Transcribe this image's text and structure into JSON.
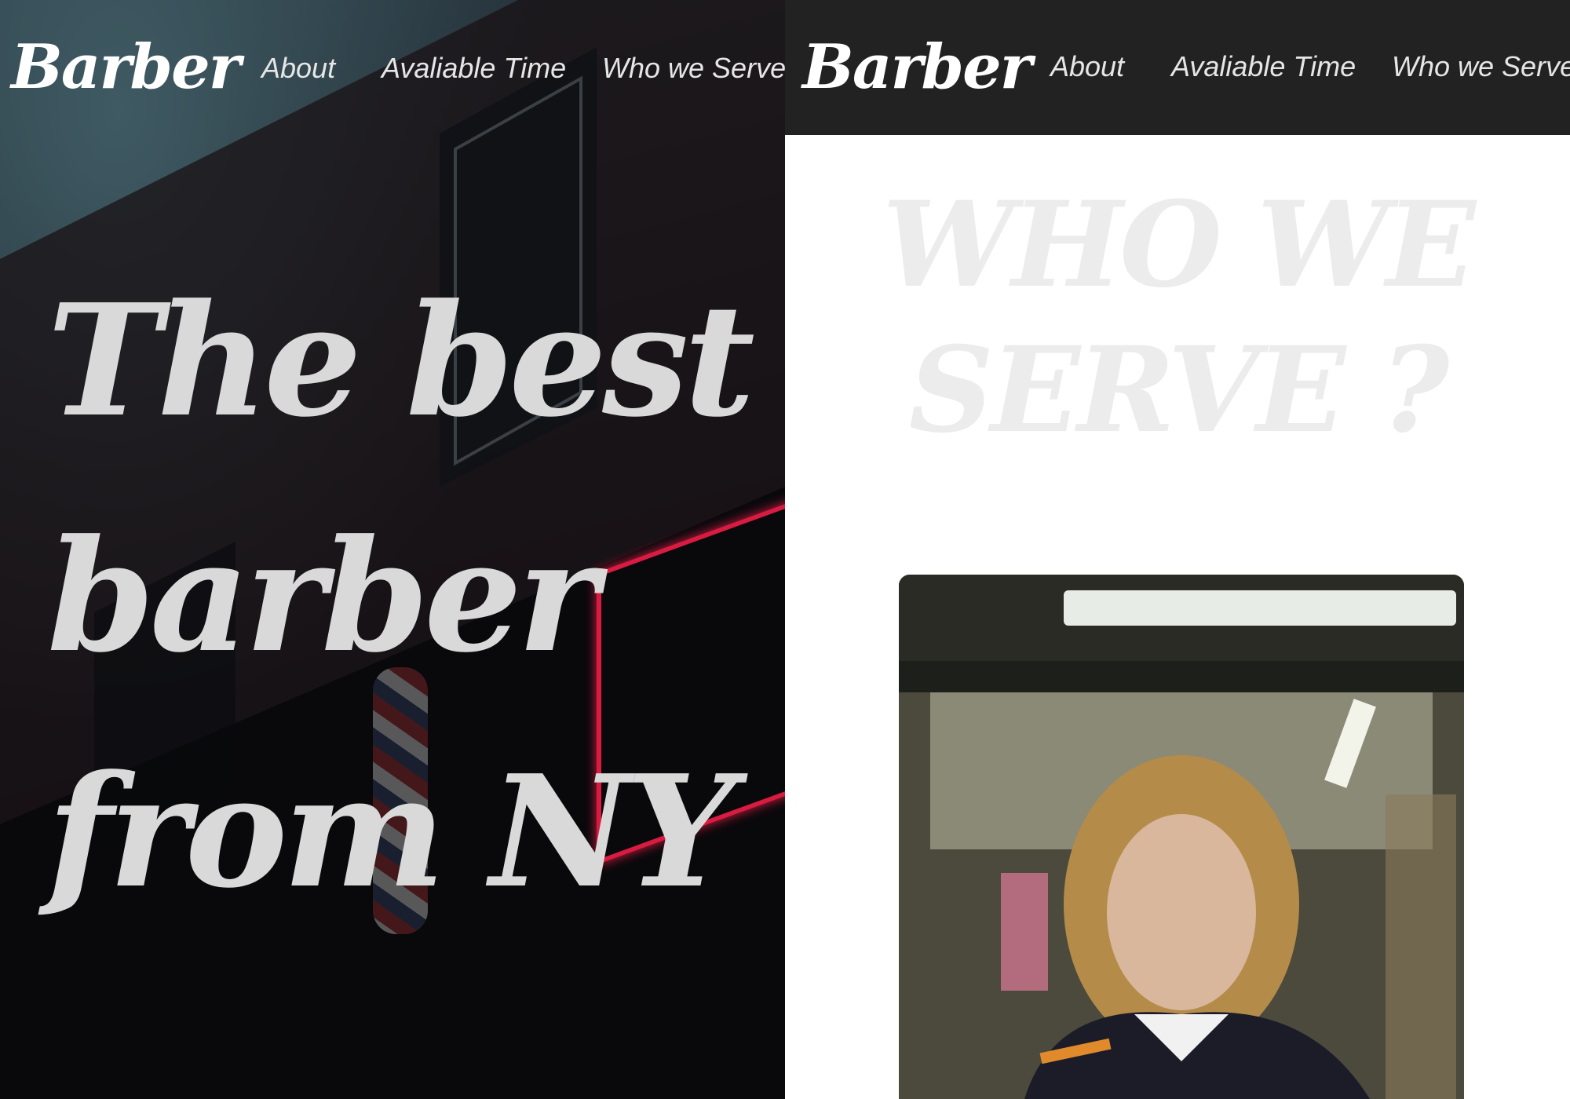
{
  "left": {
    "logo": "Barber",
    "nav": [
      {
        "label": "About"
      },
      {
        "label": "Avaliable Time"
      },
      {
        "label": "Who we Serve"
      }
    ],
    "hero_lines": [
      "The best",
      "barber",
      "from NY"
    ]
  },
  "right": {
    "logo": "Barber",
    "nav": [
      {
        "label": "About"
      },
      {
        "label": "Avaliable Time"
      },
      {
        "label": "Who we Serve"
      }
    ],
    "section_title_lines": [
      "WHO WE",
      "SERVE ?"
    ]
  },
  "colors": {
    "nav_bg": "#222222",
    "hero_text": "#d9d9d9",
    "section_title": "#ececec",
    "neon": "#ff1f4b"
  },
  "icons": [
    "barber-pole-graphic",
    "neon-sign-graphic"
  ]
}
